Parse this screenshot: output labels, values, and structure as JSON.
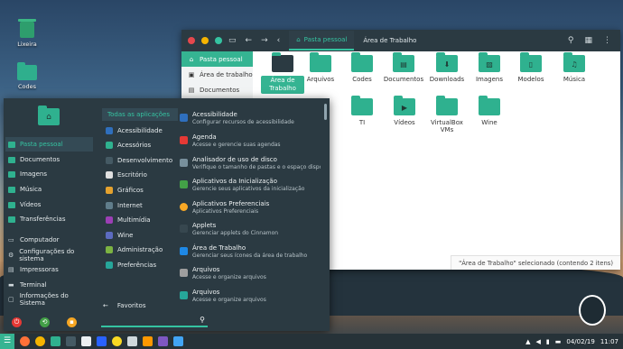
{
  "desktop": {
    "icons": [
      {
        "label": "Lixeira"
      },
      {
        "label": "Codes"
      }
    ]
  },
  "file_manager": {
    "breadcrumb": {
      "home": "Pasta pessoal",
      "current": "Área de Trabalho"
    },
    "sidebar": [
      {
        "label": "Pasta pessoal",
        "icon": "home-icon"
      },
      {
        "label": "Área de trabalho",
        "icon": "desktop-icon"
      },
      {
        "label": "Documentos",
        "icon": "document-icon"
      }
    ],
    "items": [
      {
        "label": "Área de Trabalho",
        "selected": true
      },
      {
        "label": "Arquivos"
      },
      {
        "label": "Codes"
      },
      {
        "label": "Documentos"
      },
      {
        "label": "Downloads"
      },
      {
        "label": "Imagens"
      },
      {
        "label": "Modelos"
      },
      {
        "label": "Música"
      },
      {
        "label": "e"
      },
      {
        "label": "TI"
      },
      {
        "label": "Vídeos"
      },
      {
        "label": "VirtualBox VMs"
      },
      {
        "label": "Wine"
      }
    ],
    "status": "\"Área de Trabalho\" selecionado (contendo 2 itens)"
  },
  "menu": {
    "places": [
      {
        "label": "Pasta pessoal"
      },
      {
        "label": "Documentos"
      },
      {
        "label": "Imagens"
      },
      {
        "label": "Música"
      },
      {
        "label": "Vídeos"
      },
      {
        "label": "Transferências"
      }
    ],
    "system": [
      {
        "label": "Computador"
      },
      {
        "label": "Configurações do sistema"
      },
      {
        "label": "Impressoras"
      },
      {
        "label": "Terminal"
      },
      {
        "label": "Informações do Sistema"
      }
    ],
    "categories_header": "Todas as aplicações",
    "categories": [
      {
        "label": "Acessibilidade",
        "color": "#2f6fbd"
      },
      {
        "label": "Acessórios",
        "color": "#2fb18f"
      },
      {
        "label": "Desenvolvimento",
        "color": "#455a64"
      },
      {
        "label": "Escritório",
        "color": "#e0e0e0"
      },
      {
        "label": "Gráficos",
        "color": "#e5a22e"
      },
      {
        "label": "Internet",
        "color": "#607d8b"
      },
      {
        "label": "Multimídia",
        "color": "#9c3fb5"
      },
      {
        "label": "Wine",
        "color": "#5c6bc0"
      },
      {
        "label": "Administração",
        "color": "#7cb342"
      },
      {
        "label": "Preferências",
        "color": "#26a69a"
      }
    ],
    "apps": [
      {
        "name": "Acessibilidade",
        "desc": "Configurar recursos de acessibilidade",
        "color": "#2f6fbd"
      },
      {
        "name": "Agenda",
        "desc": "Acesse e gerencie suas agendas",
        "color": "#e53935"
      },
      {
        "name": "Analisador de uso de disco",
        "desc": "Verifique o tamanho de pastas e o espaço disponive...",
        "color": "#78909c"
      },
      {
        "name": "Aplicativos da Inicialização",
        "desc": "Gerencie seus aplicativos da inicialização",
        "color": "#43a047"
      },
      {
        "name": "Aplicativos Preferenciais",
        "desc": "Aplicativos Preferenciais",
        "color": "#f9a825"
      },
      {
        "name": "Applets",
        "desc": "Gerenciar applets do Cinnamon",
        "color": "#37474f"
      },
      {
        "name": "Área de Trabalho",
        "desc": "Gerenciar seus ícones da área de trabalho",
        "color": "#1e88e5"
      },
      {
        "name": "Arquivos",
        "desc": "Acesse e organize arquivos",
        "color": "#9e9e9e"
      },
      {
        "name": "Arquivos",
        "desc": "Acesse e organize arquivos",
        "color": "#26a69a"
      }
    ],
    "favorites": "Favoritos",
    "search_placeholder": ""
  },
  "taskbar": {
    "date": "04/02/19",
    "time": "11:07"
  },
  "colors": {
    "accent": "#35b492",
    "panel": "#2b3a42"
  }
}
